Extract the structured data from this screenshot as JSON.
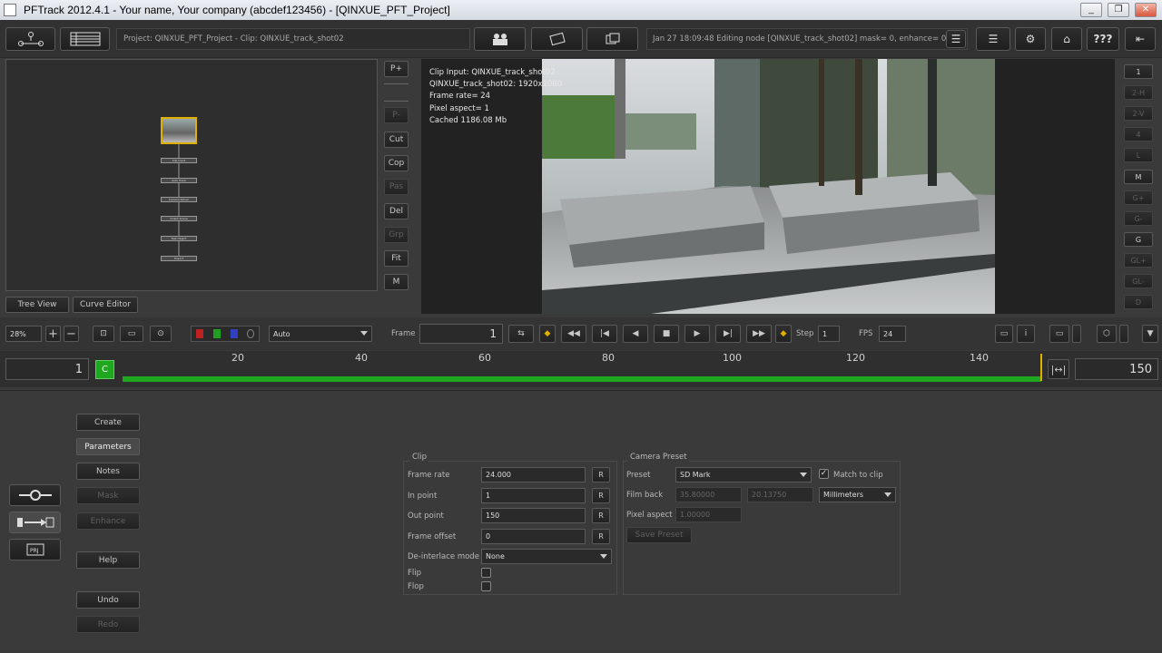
{
  "window": {
    "title": "PFTrack 2012.4.1 - Your name, Your company (abcdef123456) - [QINXUE_PFT_Project]",
    "min_icon": "minimize-icon",
    "max_icon": "restore-icon",
    "close_icon": "close-icon"
  },
  "toolbar": {
    "project_text": "Project: QINXUE_PFT_Project - Clip: QINXUE_track_shot02",
    "status_text": "Jan 27 18:09:48 Editing node [QINXUE_track_shot02] mask= 0, enhance= 0",
    "help_label": "???"
  },
  "node_side_buttons": [
    "P+",
    "P-",
    "Cut",
    "Cop",
    "Pas",
    "Del",
    "Grp",
    "Fit",
    "M"
  ],
  "node_labels": [
    "Clip Input",
    "Auto Track",
    "Camera Solver",
    "Orient Scene",
    "Test Object",
    "Export"
  ],
  "tabs": {
    "tree_view": "Tree View",
    "curve_editor": "Curve Editor"
  },
  "viewer_info": [
    "Clip Input: QINXUE_track_shot02",
    "QINXUE_track_shot02: 1920x1080",
    "Frame rate= 24",
    "Pixel aspect= 1",
    "Cached 1186.08 Mb"
  ],
  "right_buttons": [
    "1",
    "2-H",
    "2-V",
    "4",
    "L",
    "M",
    "G+",
    "G-",
    "G",
    "GL+",
    "GL-",
    "D"
  ],
  "controls": {
    "zoom": "28%",
    "display_mode": "Auto",
    "frame_label": "Frame",
    "frame_value": "1",
    "step_label": "Step",
    "step_value": "1",
    "fps_label": "FPS",
    "fps_value": "24"
  },
  "timeline": {
    "start": "1",
    "end": "150",
    "current_marker": "C",
    "ticks": [
      "20",
      "40",
      "60",
      "80",
      "100",
      "120",
      "140"
    ]
  },
  "left_menu": [
    "Create",
    "Parameters",
    "Notes",
    "Mask",
    "Enhance",
    "Help",
    "Undo",
    "Redo"
  ],
  "clip_panel": {
    "title": "Clip",
    "frame_rate_label": "Frame rate",
    "frame_rate": "24.000",
    "in_point_label": "In point",
    "in_point": "1",
    "out_point_label": "Out point",
    "out_point": "150",
    "frame_offset_label": "Frame offset",
    "frame_offset": "0",
    "deinterlace_label": "De-interlace mode",
    "deinterlace": "None",
    "flip_label": "Flip",
    "flop_label": "Flop",
    "reset_label": "R"
  },
  "camera_panel": {
    "title": "Camera Preset",
    "preset_label": "Preset",
    "preset": "SD Mark",
    "match_label": "Match to clip",
    "film_back_label": "Film back",
    "film_back_w": "35.80000",
    "film_back_h": "20.13750",
    "units": "Millimeters",
    "pixel_aspect_label": "Pixel aspect",
    "pixel_aspect": "1.00000",
    "save_label": "Save Preset"
  },
  "colors": {
    "accent_green": "#1fa81f",
    "node_selected": "#e0b000"
  }
}
